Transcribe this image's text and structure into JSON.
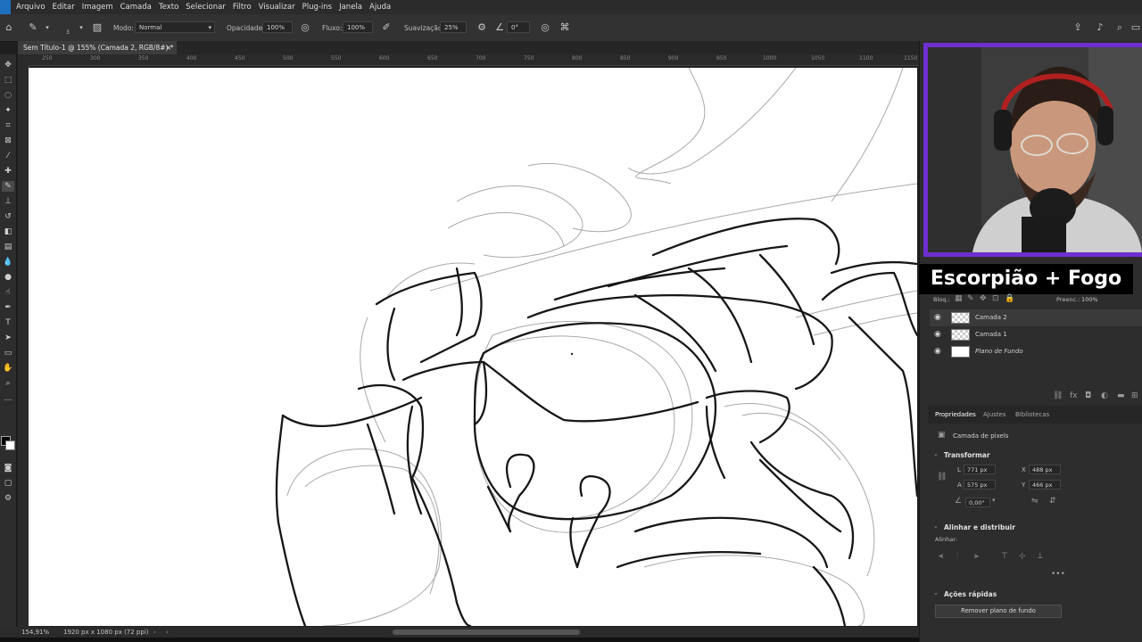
{
  "menu": [
    "Arquivo",
    "Editar",
    "Imagem",
    "Camada",
    "Texto",
    "Selecionar",
    "Filtro",
    "Visualizar",
    "Plug-ins",
    "Janela",
    "Ajuda"
  ],
  "options": {
    "brush_size": "3",
    "mode_label": "Modo:",
    "mode_value": "Normal",
    "opacity_label": "Opacidade:",
    "opacity_value": "100%",
    "flow_label": "Fluxo:",
    "flow_value": "100%",
    "smoothing_label": "Suavização:",
    "smoothing_value": "25%",
    "angle_value": "0°"
  },
  "document": {
    "tab_title": "Sem Título-1 @ 155% (Camada 2, RGB/8#) *",
    "zoom": "154,91%",
    "doc_info": "1920 px x 1080 px (72 ppi)"
  },
  "ruler": {
    "ticks": [
      "250",
      "300",
      "350",
      "400",
      "450",
      "500",
      "550",
      "600",
      "650",
      "700",
      "750",
      "800",
      "850",
      "900",
      "950",
      "1000",
      "1050",
      "1100",
      "1150"
    ]
  },
  "overlay": {
    "title": "Escorpião + Fogo"
  },
  "layers_panel": {
    "lock_label": "Bloq.:",
    "fill_label": "Preenc.:",
    "fill_value": "100%",
    "layers": [
      {
        "name": "Camada 2",
        "active": true
      },
      {
        "name": "Camada 1",
        "active": false
      },
      {
        "name": "Plano de Fundo",
        "active": false
      }
    ]
  },
  "properties_panel": {
    "tabs": [
      "Propriedades",
      "Ajustes",
      "Bibliotecas"
    ],
    "layer_type": "Camada de pixels",
    "transform_title": "Transformar",
    "w_label": "L",
    "w_value": "771 px",
    "h_label": "A",
    "h_value": "575 px",
    "x_label": "X",
    "x_value": "488 px",
    "y_label": "Y",
    "y_value": "466 px",
    "angle_value": "0,00°",
    "align_title": "Alinhar e distribuir",
    "align_sub": "Alinhar:",
    "quick_actions_title": "Ações rápidas",
    "remove_bg_button": "Remover plano de fundo"
  },
  "colors": {
    "webcam_border": "#6d2fcf",
    "app_bg": "#2d2d2d",
    "canvas_bg": "#ffffff",
    "overlay_bg": "#000000",
    "overlay_text": "#ffffff"
  }
}
